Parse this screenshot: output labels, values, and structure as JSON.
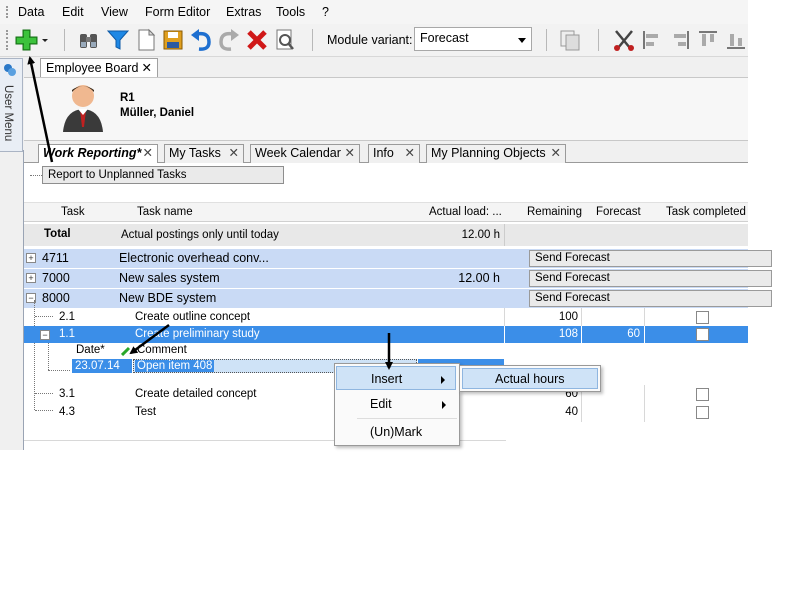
{
  "menubar": {
    "items": [
      "Data",
      "Edit",
      "View",
      "Form Editor",
      "Extras",
      "Tools",
      "?"
    ]
  },
  "toolbar": {
    "module_variant_label": "Module variant:",
    "module_variant_value": "Forecast",
    "icons": [
      "add-icon",
      "dropdown-icon",
      "binoculars-icon",
      "filter-icon",
      "new-document-icon",
      "save-icon",
      "undo-icon",
      "redo-icon",
      "delete-icon",
      "print-preview-icon",
      "compare-icon",
      "cut-icon",
      "align-left-icon",
      "align-right-icon",
      "align-top-icon",
      "align-bottom-icon"
    ]
  },
  "user_menu": {
    "label": "User Menu"
  },
  "employee_board": {
    "tab_label": "Employee Board",
    "code": "R1",
    "name": "Müller, Daniel"
  },
  "tabs": [
    {
      "label": "Work Reporting*",
      "active": true
    },
    {
      "label": "My Tasks",
      "active": false
    },
    {
      "label": "Week Calendar",
      "active": false
    },
    {
      "label": "Info",
      "active": false
    },
    {
      "label": "My Planning Objects",
      "active": false
    }
  ],
  "report_button": "Report to Unplanned Tasks",
  "grid": {
    "headers": {
      "task": "Task",
      "task_name": "Task name",
      "actual_load": "Actual load: ...",
      "remaining": "Remaining",
      "forecast": "Forecast",
      "task_completed": "Task completed"
    },
    "total": {
      "label": "Total",
      "note": "Actual postings only until today",
      "actual": "12.00 h"
    },
    "rows": [
      {
        "task": "4711",
        "name": "Electronic overhead conv...",
        "actual": "",
        "action": "Send Forecast"
      },
      {
        "task": "7000",
        "name": "New sales system",
        "actual": "12.00 h",
        "action": "Send Forecast"
      },
      {
        "task": "8000",
        "name": "New BDE system",
        "actual": "",
        "action": "Send Forecast"
      },
      {
        "task": "2.1",
        "name": "Create outline concept",
        "remaining": "100",
        "forecast": ""
      },
      {
        "task": "1.1",
        "name": "Create preliminary study",
        "remaining": "108",
        "forecast": "60"
      },
      {
        "task": "3.1",
        "name": "Create detailed concept",
        "remaining": "60",
        "forecast": ""
      },
      {
        "task": "4.3",
        "name": "Test",
        "remaining": "40",
        "forecast": ""
      }
    ],
    "subgrid": {
      "header_date": "Date*",
      "header_comment": "Comment",
      "date": "23.07.14",
      "comment": "Open item 408"
    }
  },
  "context_menu": {
    "items": [
      "Insert",
      "Edit",
      "(Un)Mark"
    ],
    "submenu": [
      "Actual hours"
    ]
  },
  "colors": {
    "group_row": "#c9daf5",
    "selected_row": "#3b8ee8",
    "selection_highlight": "#cfe3f7"
  }
}
